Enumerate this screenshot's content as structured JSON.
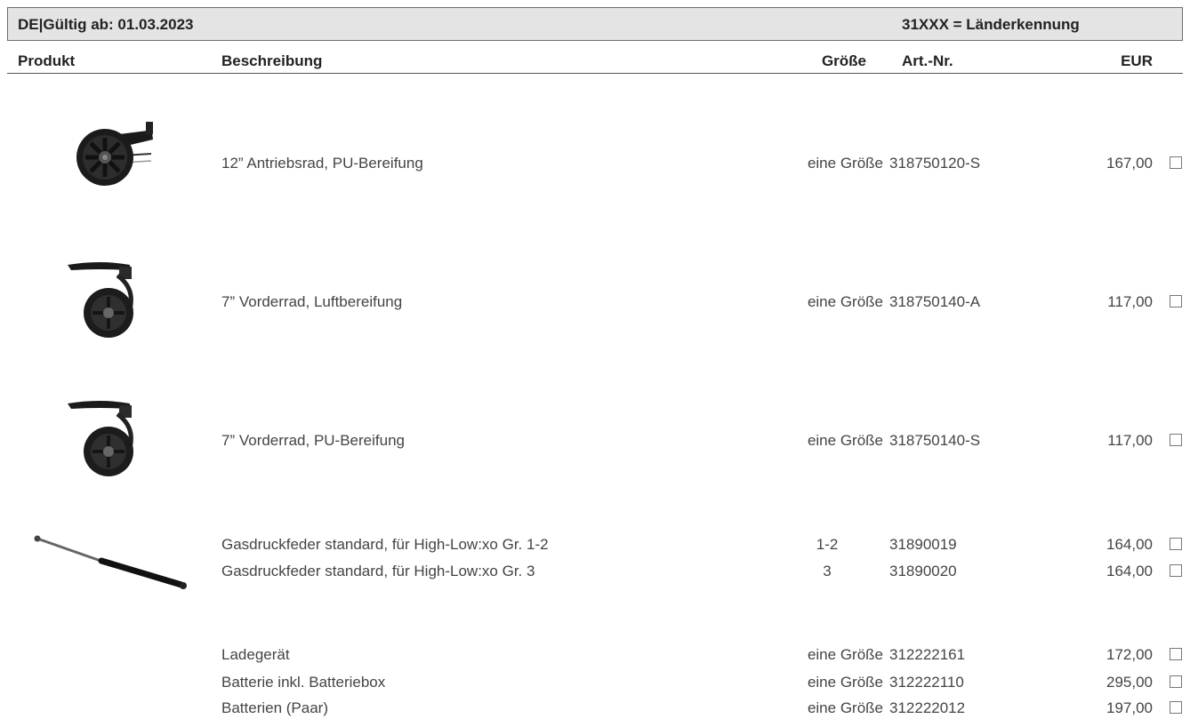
{
  "header": {
    "left": "DE|Gültig ab: 01.03.2023",
    "right": "31XXX = Länderkennung"
  },
  "columns": {
    "produkt": "Produkt",
    "beschreibung": "Beschreibung",
    "groesse": "Größe",
    "artnr": "Art.-Nr.",
    "eur": "EUR"
  },
  "rows": [
    {
      "beschreibung": "12” Antriebsrad, PU-Bereifung",
      "groesse": "eine Größe",
      "artnr": "318750120-S",
      "eur": "167,00"
    },
    {
      "beschreibung": "7” Vorderrad, Luftbereifung",
      "groesse": "eine Größe",
      "artnr": "318750140-A",
      "eur": "117,00"
    },
    {
      "beschreibung": "7” Vorderrad, PU-Bereifung",
      "groesse": "eine Größe",
      "artnr": "318750140-S",
      "eur": "117,00"
    },
    {
      "beschreibung": "Gasdruckfeder standard, für High-Low:xo Gr. 1-2",
      "groesse": "1-2",
      "artnr": "31890019",
      "eur": "164,00"
    },
    {
      "beschreibung": "Gasdruckfeder standard, für High-Low:xo Gr. 3",
      "groesse": "3",
      "artnr": "31890020",
      "eur": "164,00"
    },
    {
      "beschreibung": "Ladegerät",
      "groesse": "eine Größe",
      "artnr": "312222161",
      "eur": "172,00"
    },
    {
      "beschreibung": "Batterie inkl. Batteriebox",
      "groesse": "eine Größe",
      "artnr": "312222110",
      "eur": "295,00"
    },
    {
      "beschreibung": "Batterien (Paar)",
      "groesse": "eine Größe",
      "artnr": "312222012",
      "eur": "197,00"
    }
  ],
  "images": {
    "drive_wheel": "drive-wheel-image",
    "front_wheel_air": "front-wheel-air-image",
    "front_wheel_pu": "front-wheel-pu-image",
    "gas_spring": "gas-spring-image"
  }
}
